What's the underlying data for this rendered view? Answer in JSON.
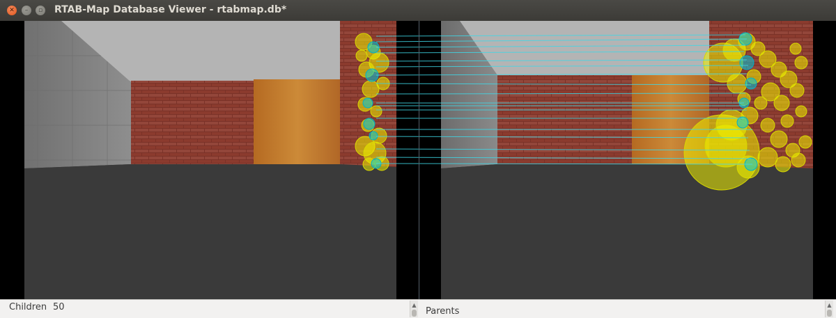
{
  "window": {
    "title": "RTAB-Map Database Viewer - rtabmap.db*",
    "buttons": [
      "close",
      "minimize",
      "maximize"
    ]
  },
  "views": {
    "children_image": "left camera image with features",
    "parents_image": "right camera image with features",
    "feature_color_matched": "#00c8dc",
    "feature_color_unmatched": "#f0f000",
    "match_line_color": "#3fd7e6"
  },
  "bottom": {
    "children_label": "Children",
    "children_value": "50",
    "parents_label": "Parents"
  },
  "icons": {
    "close": "close-icon",
    "minimize": "minimize-icon",
    "maximize": "maximize-icon",
    "scroll_up": "scroll-up-arrow-icon"
  }
}
